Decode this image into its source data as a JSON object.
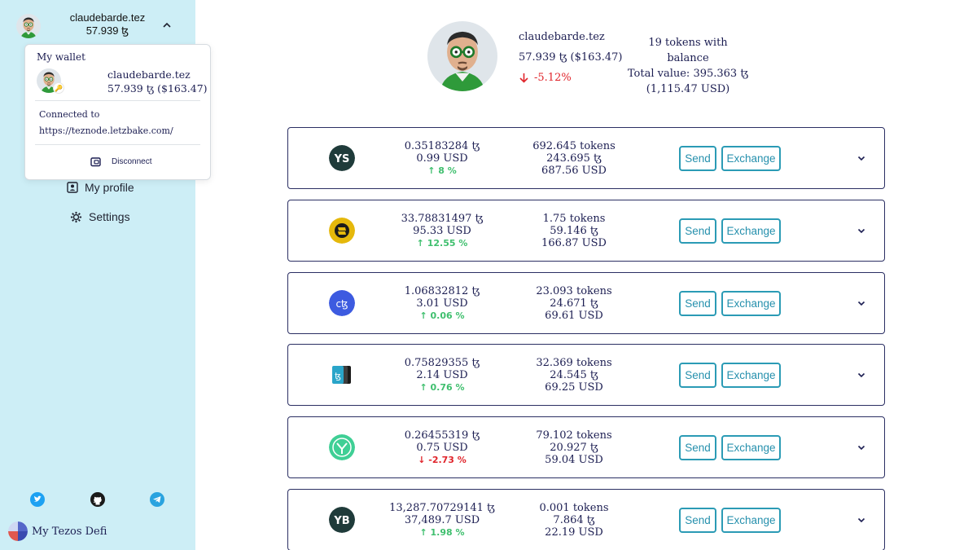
{
  "account": {
    "name": "claudebarde.tez",
    "balance_short": "57.939 ꜩ",
    "balance_full": "57.939 ꜩ ($163.47)"
  },
  "wallet_menu": {
    "title": "My wallet",
    "connected_label": "Connected to",
    "node_url": "https://teznode.letzbake.com/",
    "disconnect_label": "Disconnect"
  },
  "sidebar": {
    "nav": [
      {
        "label": "My profile",
        "icon": "profile-icon"
      },
      {
        "label": "Settings",
        "icon": "gear-icon"
      }
    ],
    "social": [
      "twitter-icon",
      "github-icon",
      "telegram-icon"
    ],
    "brand": "My Tezos Defi"
  },
  "profile": {
    "change": "-5.12%",
    "tokens_summary": "19 tokens with balance",
    "total_value": "Total value: 395.363 ꜩ",
    "total_usd": "(1,115.47 USD)"
  },
  "token_actions": {
    "send": "Send",
    "exchange": "Exchange"
  },
  "tokens": [
    {
      "icon": "ys-token-icon",
      "price_xtz": "0.35183284 ꜩ",
      "price_usd": "0.99 USD",
      "change": "8 %",
      "direction": "up",
      "amount": "692.645 tokens",
      "value_xtz": "243.695 ꜩ",
      "value_usd": "687.56 USD",
      "color": "#1f3b3a"
    },
    {
      "icon": "yellow-coin-token-icon",
      "price_xtz": "33.78831497 ꜩ",
      "price_usd": "95.33 USD",
      "change": "12.55 %",
      "direction": "up",
      "amount": "1.75 tokens",
      "value_xtz": "59.146 ꜩ",
      "value_usd": "166.87 USD",
      "color": "#e5b80b"
    },
    {
      "icon": "ctez-token-icon",
      "price_xtz": "1.06832812 ꜩ",
      "price_usd": "3.01 USD",
      "change": "0.06 %",
      "direction": "up",
      "amount": "23.093 tokens",
      "value_xtz": "24.671 ꜩ",
      "value_usd": "69.61 USD",
      "color": "#3d5be0"
    },
    {
      "icon": "stacked-tez-token-icon",
      "price_xtz": "0.75829355 ꜩ",
      "price_usd": "2.14 USD",
      "change": "0.76 %",
      "direction": "up",
      "amount": "32.369 tokens",
      "value_xtz": "24.545 ꜩ",
      "value_usd": "69.25 USD",
      "color": "#2aa5c9"
    },
    {
      "icon": "green-leaf-token-icon",
      "price_xtz": "0.26455319 ꜩ",
      "price_usd": "0.75 USD",
      "change": "-2.73 %",
      "direction": "down",
      "amount": "79.102 tokens",
      "value_xtz": "20.927 ꜩ",
      "value_usd": "59.04 USD",
      "color": "#3fcf95"
    },
    {
      "icon": "yb-token-icon",
      "price_xtz": "13,287.70729141 ꜩ",
      "price_usd": "37,489.7 USD",
      "change": "1.98 %",
      "direction": "up",
      "amount": "0.001 tokens",
      "value_xtz": "7.864 ꜩ",
      "value_usd": "22.19 USD",
      "color": "#1f3b3a"
    }
  ]
}
